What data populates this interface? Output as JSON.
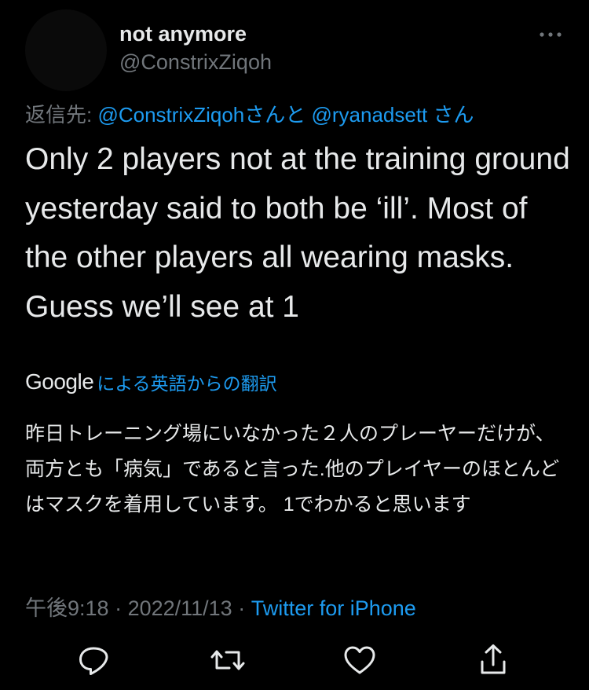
{
  "author": {
    "display_name": "not anymore",
    "handle": "@ConstrixZiqoh"
  },
  "icons": {
    "more": "more-icon",
    "reply": "reply-icon",
    "retweet": "retweet-icon",
    "like": "like-icon",
    "share": "share-icon"
  },
  "reply_to": {
    "prefix": "返信先: ",
    "mention1": "@ConstrixZiqoh",
    "mid": "さんと ",
    "mention2": "@ryanadsett",
    "suffix": " さん"
  },
  "tweet": {
    "text": "Only 2 players not at the training ground yesterday said to both be ‘ill’. Most of the other players all wearing masks. Guess we’ll see at 1"
  },
  "translation": {
    "provider": "Google",
    "label": "による英語からの翻訳",
    "text": "昨日トレーニング場にいなかった２人のプレーヤーだけが、両方とも「病気」であると言った.他のプレイヤーのほとんどはマスクを着用しています。 1でわかると思います"
  },
  "meta": {
    "time": "午後9:18",
    "date": "2022/11/13",
    "separator": " · ",
    "source": "Twitter for iPhone"
  },
  "colors": {
    "background": "#000000",
    "text": "#e7e9ea",
    "secondary": "#71767b",
    "accent": "#1d9bf0"
  }
}
